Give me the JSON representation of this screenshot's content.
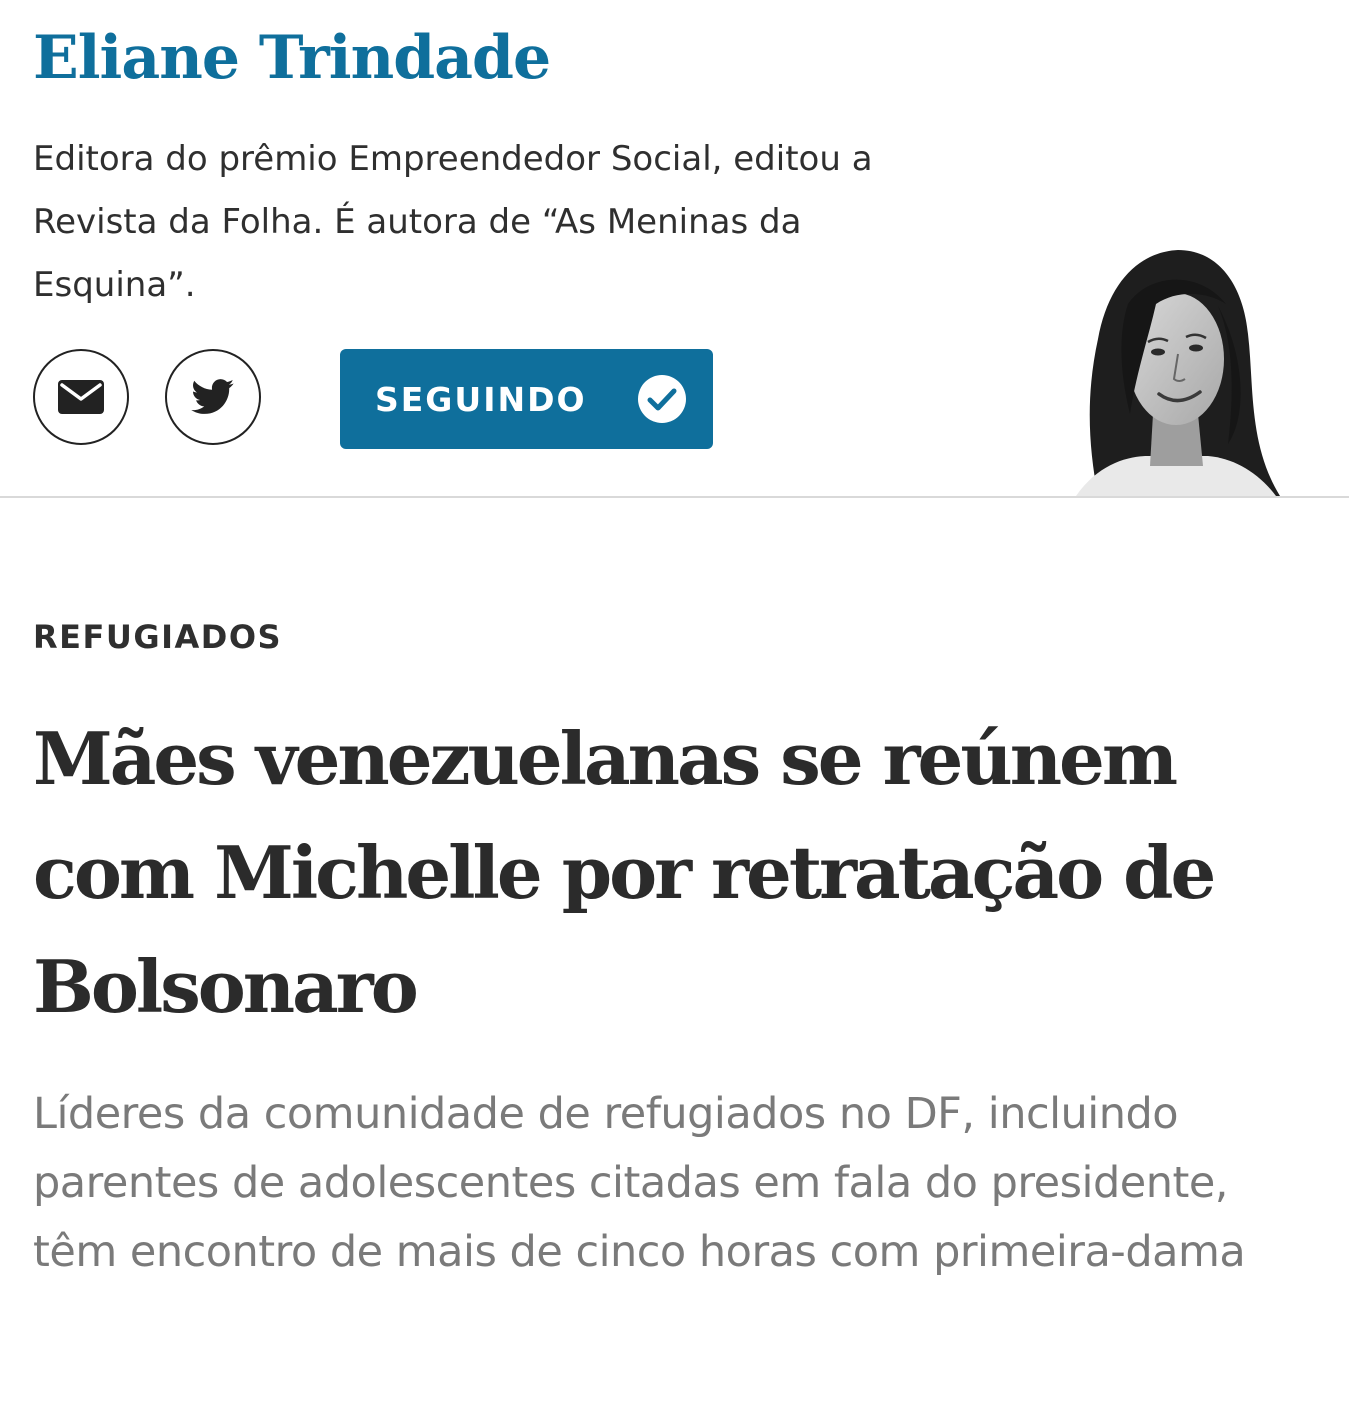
{
  "author": {
    "name": "Eliane Trindade",
    "bio": "Editora do prêmio Empreendedor Social, editou a Revista da Folha. É autora de “As Meninas da Esquina”.",
    "actions": {
      "email_icon": "envelope-icon",
      "twitter_icon": "twitter-bird-icon",
      "follow_label": "SEGUINDO",
      "follow_icon": "check-circle-icon"
    },
    "photo": "author-portrait"
  },
  "article": {
    "kicker": "REFUGIADOS",
    "headline": "Mães venezuelanas se reúnem com Michelle por retratação de Bolsonaro",
    "subheadline": "Líderes da comunidade de refugiados no DF, incluindo parentes de adolescentes citadas em fala do presidente, têm encontro de mais de cinco horas com primeira-dama"
  },
  "colors": {
    "brand_blue": "#0f6f9c",
    "text_dark": "#2b2b2b",
    "text_muted": "#7a7a7a",
    "divider": "#d9d9d9"
  }
}
